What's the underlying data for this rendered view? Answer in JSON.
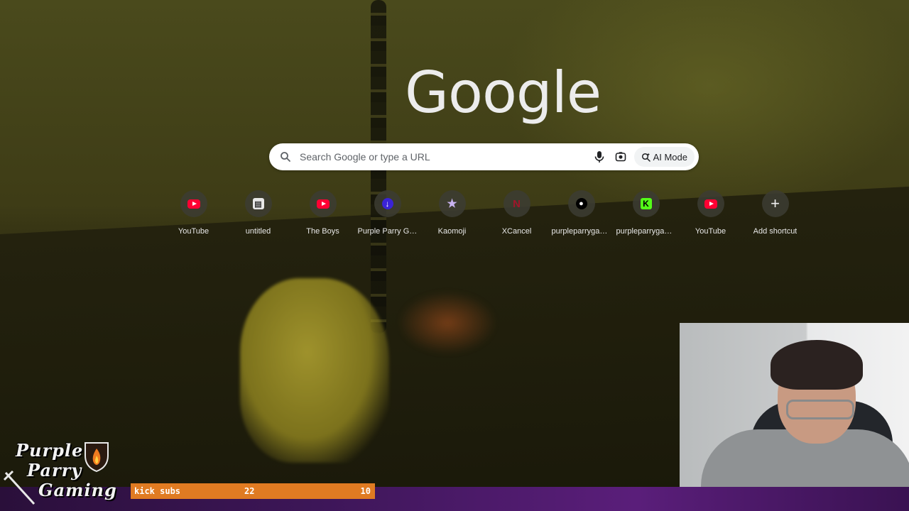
{
  "logo": {
    "text": "Google"
  },
  "search": {
    "placeholder": "Search Google or type a URL",
    "ai_mode_label": "AI Mode"
  },
  "shortcuts": [
    {
      "label": "YouTube",
      "icon": "youtube-icon"
    },
    {
      "label": "untitled",
      "icon": "doc-icon"
    },
    {
      "label": "The Boys",
      "icon": "youtube-icon"
    },
    {
      "label": "Purple Parry Ga...",
      "icon": "purple-parry-icon"
    },
    {
      "label": "Kaomoji",
      "icon": "star-icon"
    },
    {
      "label": "XCancel",
      "icon": "netflix-n-icon"
    },
    {
      "label": "purpleparrygam...",
      "icon": "patreon-icon"
    },
    {
      "label": "purpleparrygam...",
      "icon": "kick-icon"
    },
    {
      "label": "YouTube",
      "icon": "youtube-icon"
    },
    {
      "label": "Add shortcut",
      "icon": "plus-icon"
    }
  ],
  "overlay": {
    "brand_line1": "Purple",
    "brand_line2": "Parry",
    "brand_line3": "Gaming",
    "subs_label": "kick subs",
    "subs_count": "22",
    "subs_goal": "10"
  },
  "colors": {
    "subs_bar": "#e07b22",
    "bottom_bar": "#3d1658",
    "youtube_red": "#ff0033",
    "kick_green": "#53fc18"
  }
}
